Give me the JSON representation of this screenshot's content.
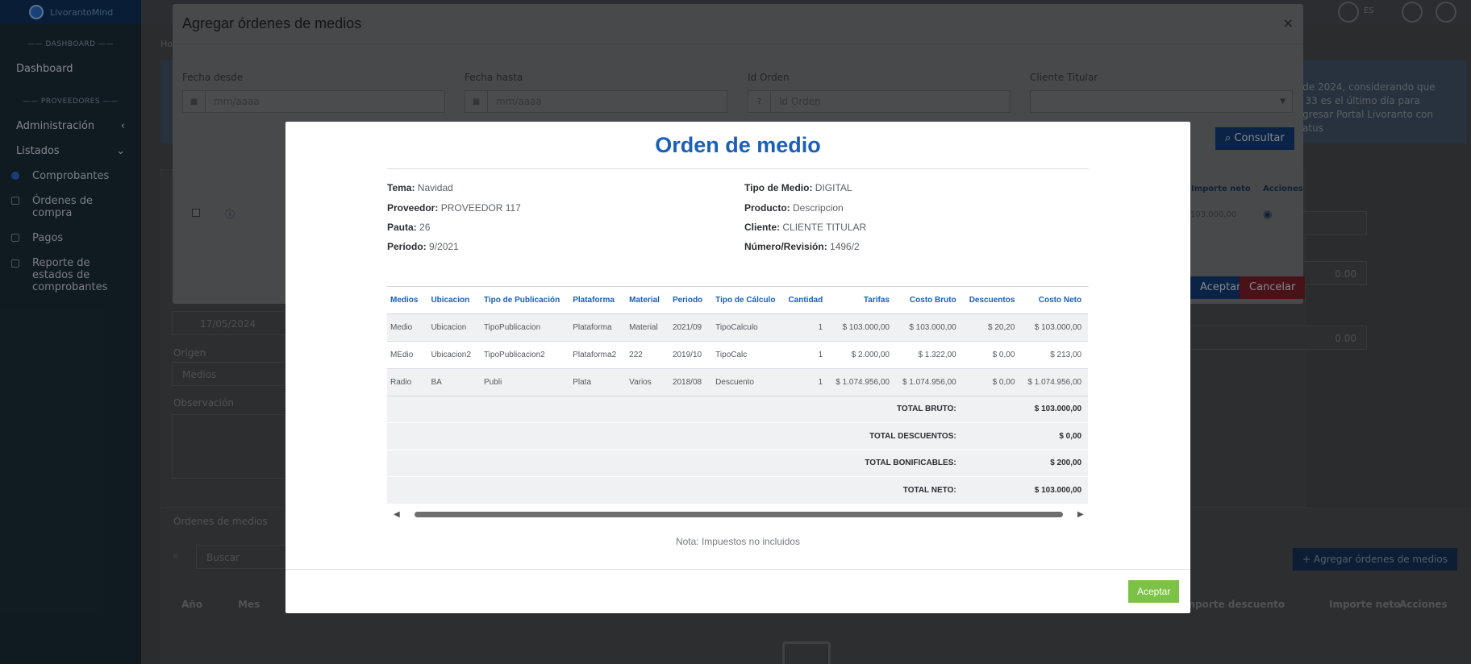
{
  "sidebar": {
    "brand": "LivorantoMind",
    "section_dashboard": "DASHBOARD",
    "section_proveedores": "PROVEEDORES",
    "items": {
      "dashboard": "Dashboard",
      "administracion": "Administración",
      "listados": "Listados",
      "comprobantes": "Comprobantes",
      "ordenes_compra": "Órdenes de compra",
      "pagos": "Pagos",
      "reporte": "Reporte de estados de comprobantes"
    }
  },
  "topbar": {
    "lang": "ES"
  },
  "background": {
    "crumb": "Ho",
    "info_text": "o de 2024, considerando que la 33 es el último día para ingresar Portal Livoranto con status",
    "fecha_ingreso": "17/05/2024",
    "origen_label": "Origen",
    "origen_value": "Medios",
    "observacion_label": "Observación",
    "amount_1": "0.00",
    "amount_2": "0.00",
    "ordenes_label": "Órdenes de medios",
    "search_placeholder": "Buscar",
    "add_button": "Agregar órdenes de medios",
    "col_anio": "Año",
    "col_mes": "Mes",
    "col_importe_descuento": "Importe descuento",
    "col_importe_neto": "Importe neto",
    "col_acciones": "Acciones"
  },
  "modal1": {
    "title": "Agregar órdenes de medios",
    "close": "×",
    "fecha_desde_label": "Fecha desde",
    "fecha_desde_placeholder": "mm/aaaa",
    "fecha_hasta_label": "Fecha hasta",
    "fecha_hasta_placeholder": "mm/aaaa",
    "id_orden_label": "Id Orden",
    "id_orden_placeholder": "Id Orden",
    "cliente_label": "Cliente Titular",
    "consultar": "Consultar",
    "limpiar_fragment": "s",
    "th_importe_neto": "Importe neto",
    "th_acciones": "Acciones",
    "row_importe": "103.000,00",
    "aceptar": "Aceptar",
    "cancelar": "Cancelar"
  },
  "orden": {
    "title": "Orden de medio",
    "left": [
      {
        "label": "Tema:",
        "value": "Navidad"
      },
      {
        "label": "Proveedor:",
        "value": "PROVEEDOR 117"
      },
      {
        "label": "Pauta:",
        "value": "26"
      },
      {
        "label": "Período:",
        "value": "9/2021"
      }
    ],
    "right": [
      {
        "label": "Tipo de Medio:",
        "value": "DIGITAL"
      },
      {
        "label": "Producto:",
        "value": "Descripcion"
      },
      {
        "label": "Cliente:",
        "value": "CLIENTE TITULAR"
      },
      {
        "label": "Número/Revisión:",
        "value": "1496/2"
      }
    ],
    "columns": [
      "Medios",
      "Ubicacion",
      "Tipo de Publicación",
      "Plataforma",
      "Material",
      "Periodo",
      "Tipo de Cálculo",
      "Cantidad",
      "Tarifas",
      "Costo Bruto",
      "Descuentos",
      "Costo Neto"
    ],
    "rows": [
      [
        "Medio",
        "Ubicacion",
        "TipoPublicacion",
        "Plataforma",
        "Material",
        "2021/09",
        "TipoCalculo",
        "1",
        "$ 103.000,00",
        "$ 103.000,00",
        "$ 20,20",
        "$ 103.000,00"
      ],
      [
        "MEdio",
        "Ubicacion2",
        "TipoPublicacion2",
        "Plataforma2",
        "222",
        "2019/10",
        "TipoCalc",
        "1",
        "$ 2.000,00",
        "$ 1.322,00",
        "$ 0,00",
        "$ 213,00"
      ],
      [
        "Radio",
        "BA",
        "Publi",
        "Plata",
        "Varios",
        "2018/08",
        "Descuento",
        "1",
        "$ 1.074.956,00",
        "$ 1.074.956,00",
        "$ 0,00",
        "$ 1.074.956,00"
      ]
    ],
    "totals": [
      {
        "label": "TOTAL BRUTO:",
        "value": "$ 103.000,00"
      },
      {
        "label": "TOTAL DESCUENTOS:",
        "value": "$ 0,00"
      },
      {
        "label": "TOTAL BONIFICABLES:",
        "value": "$ 200,00"
      },
      {
        "label": "TOTAL NETO:",
        "value": "$ 103.000,00"
      }
    ],
    "note": "Nota: Impuestos no incluidos",
    "accept": "Aceptar"
  }
}
